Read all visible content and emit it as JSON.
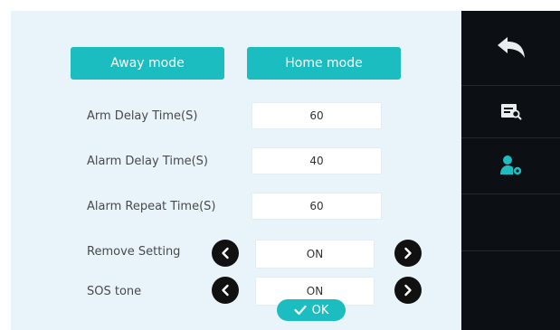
{
  "modes": {
    "away_label": "Away mode",
    "home_label": "Home mode"
  },
  "settings": [
    {
      "label": "Arm Delay Time(S)",
      "value": "60"
    },
    {
      "label": "Alarm Delay Time(S)",
      "value": "40"
    },
    {
      "label": "Alarm Repeat Time(S)",
      "value": "60"
    }
  ],
  "toggles": [
    {
      "label": "Remove Setting",
      "value": "ON"
    },
    {
      "label": "SOS tone",
      "value": "ON"
    }
  ],
  "ok_label": "OK",
  "colors": {
    "accent": "#1cbdc0",
    "panel_bg": "#e8f4f9",
    "sidebar_bg": "#0c0f14"
  },
  "icons": {
    "back": "back-arrow-icon",
    "log": "log-search-icon",
    "user_settings": "user-settings-icon"
  }
}
